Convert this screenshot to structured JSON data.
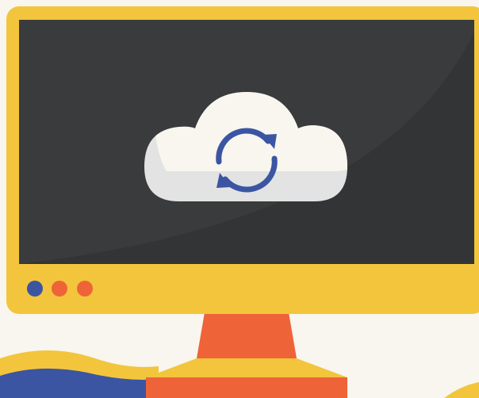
{
  "illustration": {
    "subject": "monitor-with-cloud-sync",
    "icons": [
      "cloud-icon",
      "sync-arrows-icon"
    ],
    "indicator_lights": [
      {
        "name": "indicator-light-1",
        "color": "#3b55a3"
      },
      {
        "name": "indicator-light-2",
        "color": "#ef6338"
      },
      {
        "name": "indicator-light-3",
        "color": "#ef6338"
      }
    ]
  },
  "colors": {
    "background": "#f8f6ee",
    "monitor_frame": "#f2c53d",
    "screen": "#333435",
    "screen_glare": "#3a3b3c",
    "cloud_top": "#f8f6ee",
    "cloud_bottom": "#e3e3e3",
    "sync_arrows": "#3b55a3",
    "stand": "#ef6338",
    "stand_base_top": "#f2c53d",
    "wave_yellow": "#f2c53d",
    "wave_blue": "#3b55a3"
  }
}
